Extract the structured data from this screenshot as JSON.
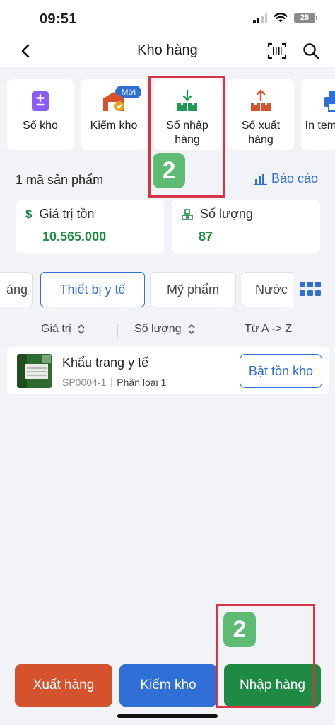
{
  "status": {
    "time": "09:51",
    "battery": "25"
  },
  "nav": {
    "title": "Kho hàng"
  },
  "shortcuts": [
    {
      "label": "Sổ kho",
      "icon": "ledger-icon"
    },
    {
      "label": "Kiểm kho",
      "icon": "warehouse-check-icon",
      "badge": "Mới"
    },
    {
      "label": "Sổ nhập hàng",
      "icon": "import-goods-icon"
    },
    {
      "label": "Sổ xuất hàng",
      "icon": "export-goods-icon"
    },
    {
      "label": "In tem vạch",
      "icon": "printer-icon"
    }
  ],
  "summary": {
    "count_label": "1 mã sản phẩm",
    "report_label": "Báo cáo",
    "stock_value_label": "Giá trị tồn",
    "stock_value": "10.565.000",
    "quantity_label": "Số lượng",
    "quantity": "87"
  },
  "categories": [
    {
      "label": "áng"
    },
    {
      "label": "Thiết bị y tế",
      "active": true
    },
    {
      "label": "Mỹ phẩm"
    },
    {
      "label": "Nước"
    }
  ],
  "sort": {
    "value": "Giá trị",
    "quantity": "Số lượng",
    "alpha": "Từ A -> Z"
  },
  "product": {
    "name": "Khẩu trang y tế",
    "sku": "SP0004-1",
    "classification": "Phân loại 1",
    "action": "Bật tồn kho"
  },
  "bottom": {
    "export": "Xuất hàng",
    "check": "Kiểm kho",
    "import": "Nhập hàng"
  },
  "annotations": {
    "step_1": "2",
    "step_2": "2"
  },
  "colors": {
    "primary": "#2f6fd6",
    "green": "#1f8a43",
    "orange": "#d5532c",
    "highlight": "#d63545",
    "step_badge": "#5dbb74"
  }
}
